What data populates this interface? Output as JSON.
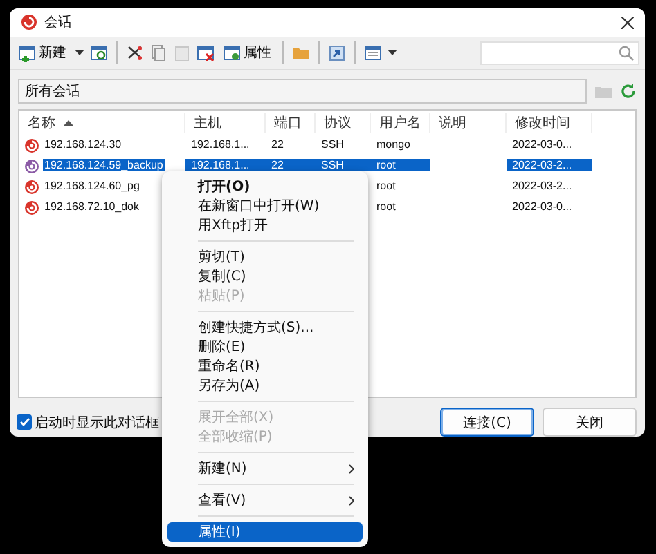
{
  "window": {
    "title": "会话"
  },
  "toolbar": {
    "new_label": "新建",
    "properties_label": "属性",
    "paste_disabled": true
  },
  "breadcrumb": {
    "path": "所有会话"
  },
  "table": {
    "columns": [
      {
        "label": "名称",
        "sorted": true
      },
      {
        "label": "主机",
        "sorted": false
      },
      {
        "label": "端口",
        "sorted": false
      },
      {
        "label": "协议",
        "sorted": false
      },
      {
        "label": "用户名",
        "sorted": false
      },
      {
        "label": "说明",
        "sorted": false
      },
      {
        "label": "修改时间",
        "sorted": false
      }
    ],
    "rows": [
      {
        "cells": [
          "192.168.124.30",
          "192.168.1...",
          "22",
          "SSH",
          "mongo",
          "",
          "2022-03-0..."
        ],
        "selected": false
      },
      {
        "cells": [
          "192.168.124.59_backup",
          "192.168.1...",
          "22",
          "SSH",
          "root",
          "",
          "2022-03-2..."
        ],
        "selected": true
      },
      {
        "cells": [
          "192.168.124.60_pg",
          "",
          "",
          "",
          "root",
          "",
          "2022-03-2..."
        ],
        "selected": false
      },
      {
        "cells": [
          "192.168.72.10_dok",
          "",
          "",
          "",
          "root",
          "",
          "2022-03-0..."
        ],
        "selected": false
      }
    ]
  },
  "startup_checkbox": {
    "label": "启动时显示此对话框",
    "checked": true
  },
  "buttons": [
    {
      "label": "连接(C)",
      "default": true
    },
    {
      "label": "关闭",
      "default": false
    }
  ],
  "context_menu": [
    {
      "kind": "item",
      "label": "打开(O)",
      "default": true,
      "disabled": false,
      "submenu": false,
      "selected": false
    },
    {
      "kind": "item",
      "label": "在新窗口中打开(W)",
      "default": false,
      "disabled": false,
      "submenu": false,
      "selected": false
    },
    {
      "kind": "item",
      "label": "用Xftp打开",
      "default": false,
      "disabled": false,
      "submenu": false,
      "selected": false
    },
    {
      "kind": "separator"
    },
    {
      "kind": "item",
      "label": "剪切(T)",
      "default": false,
      "disabled": false,
      "submenu": false,
      "selected": false
    },
    {
      "kind": "item",
      "label": "复制(C)",
      "default": false,
      "disabled": false,
      "submenu": false,
      "selected": false
    },
    {
      "kind": "item",
      "label": "粘贴(P)",
      "default": false,
      "disabled": true,
      "submenu": false,
      "selected": false
    },
    {
      "kind": "separator"
    },
    {
      "kind": "item",
      "label": "创建快捷方式(S)...",
      "default": false,
      "disabled": false,
      "submenu": false,
      "selected": false
    },
    {
      "kind": "item",
      "label": "删除(E)",
      "default": false,
      "disabled": false,
      "submenu": false,
      "selected": false
    },
    {
      "kind": "item",
      "label": "重命名(R)",
      "default": false,
      "disabled": false,
      "submenu": false,
      "selected": false
    },
    {
      "kind": "item",
      "label": "另存为(A)",
      "default": false,
      "disabled": false,
      "submenu": false,
      "selected": false
    },
    {
      "kind": "separator"
    },
    {
      "kind": "item",
      "label": "展开全部(X)",
      "default": false,
      "disabled": true,
      "submenu": false,
      "selected": false
    },
    {
      "kind": "item",
      "label": "全部收缩(P)",
      "default": false,
      "disabled": true,
      "submenu": false,
      "selected": false
    },
    {
      "kind": "separator"
    },
    {
      "kind": "item",
      "label": "新建(N)",
      "default": false,
      "disabled": false,
      "submenu": true,
      "selected": false
    },
    {
      "kind": "separator"
    },
    {
      "kind": "item",
      "label": "查看(V)",
      "default": false,
      "disabled": false,
      "submenu": true,
      "selected": false
    },
    {
      "kind": "separator"
    },
    {
      "kind": "item",
      "label": "属性(I)",
      "default": false,
      "disabled": false,
      "submenu": false,
      "selected": true
    }
  ]
}
